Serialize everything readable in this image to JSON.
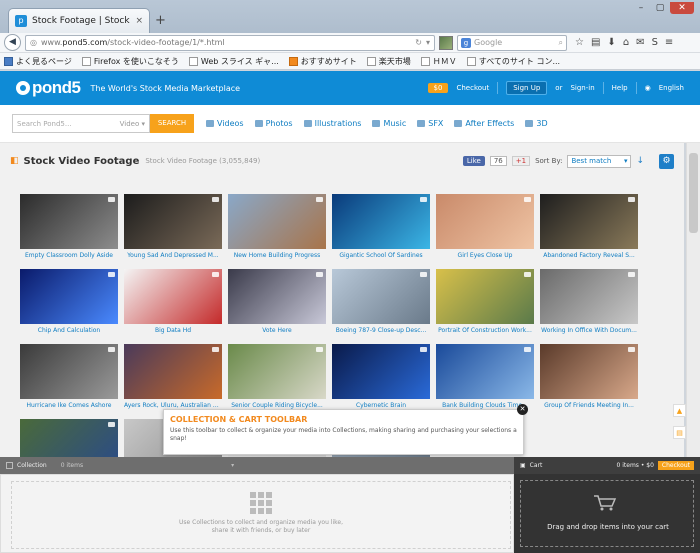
{
  "browser": {
    "tab_title": "Stock Footage | Stock ...",
    "tab_close": "×",
    "new_tab": "+",
    "url_prefix": "www.",
    "url_domain": "pond5.com",
    "url_path": "/stock-video-footage/1/*.html",
    "search_placeholder": "Google",
    "bookmarks": [
      "よく見るページ",
      "Firefox を使いこなそう",
      "Web スライス ギャ...",
      "おすすめサイト",
      "楽天市場",
      "ＨＭＶ",
      "すべてのサイト コン..."
    ]
  },
  "site": {
    "logo": "pond5",
    "tagline": "The World's Stock Media Marketplace",
    "cart_badge": "$0",
    "checkout": "Checkout",
    "signup": "Sign Up",
    "or": "or",
    "signin": "Sign-in",
    "help": "Help",
    "language": "English",
    "search_placeholder": "Search Pond5...",
    "search_filter": "Video",
    "search_button": "SEARCH",
    "categories": [
      "Videos",
      "Photos",
      "Illustrations",
      "Music",
      "SFX",
      "After Effects",
      "3D"
    ]
  },
  "page": {
    "title": "Stock Video Footage",
    "count": "Stock Video Footage (3,055,849)",
    "like": "Like",
    "like_count": "76",
    "gplus": "+1",
    "sort_label": "Sort By:",
    "sort_value": "Best match"
  },
  "clips": [
    {
      "caption": "Empty Classroom Dolly Aside",
      "colors": [
        "#2b2b2b",
        "#8d8d8d"
      ]
    },
    {
      "caption": "Young Sad And Depressed M...",
      "colors": [
        "#1c1c1c",
        "#7a6a58"
      ]
    },
    {
      "caption": "New Home Building Progress",
      "colors": [
        "#8aa8c8",
        "#a8744a"
      ]
    },
    {
      "caption": "Gigantic School Of Sardines",
      "colors": [
        "#0a3a7a",
        "#3bb6e6"
      ]
    },
    {
      "caption": "Girl Eyes Close Up",
      "colors": [
        "#c98a6a",
        "#efc4a4"
      ]
    },
    {
      "caption": "Abandoned Factory Reveal S...",
      "colors": [
        "#1e1e1e",
        "#8a7a5a"
      ]
    },
    {
      "caption": "Chip And Calculation",
      "colors": [
        "#0a1a6a",
        "#4a8aff"
      ]
    },
    {
      "caption": "Big Data Hd",
      "colors": [
        "#f4f4f4",
        "#c42a2a"
      ]
    },
    {
      "caption": "Vote Here",
      "colors": [
        "#3a3a4a",
        "#c8c8d8"
      ]
    },
    {
      "caption": "Boeing 787-9 Close-up Desc...",
      "colors": [
        "#b8c8d8",
        "#6a7a8a"
      ]
    },
    {
      "caption": "Portrait Of Construction Work...",
      "colors": [
        "#d8c04a",
        "#5a7a4a"
      ]
    },
    {
      "caption": "Working In Office With Docum...",
      "colors": [
        "#6a6a6a",
        "#c8c8c8"
      ]
    },
    {
      "caption": "Hurricane Ike Comes Ashore",
      "colors": [
        "#3a3a3a",
        "#9a9a9a"
      ]
    },
    {
      "caption": "Ayers Rock, Uluru, Australian C...",
      "colors": [
        "#4a3a5a",
        "#c86a2a"
      ]
    },
    {
      "caption": "Senior Couple Riding Bicycle...",
      "colors": [
        "#6a8a4a",
        "#d8d8c8"
      ]
    },
    {
      "caption": "Cybernetic Brain",
      "colors": [
        "#0a1a4a",
        "#2a6ad8"
      ]
    },
    {
      "caption": "Bank Building Clouds Time...",
      "colors": [
        "#1a4a9a",
        "#8ab8e8"
      ]
    },
    {
      "caption": "Group Of Friends Meeting In...",
      "colors": [
        "#5a3a2a",
        "#d8a88a"
      ]
    },
    {
      "caption": "",
      "colors": [
        "#4a6a3a",
        "#2a4a8a"
      ]
    },
    {
      "caption": "",
      "colors": [
        "#c8c8c8",
        "#8a8a8a"
      ]
    },
    {
      "caption": "",
      "colors": [
        "#f0f0f0",
        "#dddddd"
      ]
    },
    {
      "caption": "",
      "colors": [
        "#a8b8c8",
        "#6a7a8a"
      ]
    }
  ],
  "tooltip": {
    "title": "COLLECTION & CART TOOLBAR",
    "body": "Use this toolbar to collect & organize your media into Collections, making sharing and purchasing your selections a snap!"
  },
  "collection": {
    "label": "Collection",
    "count": "0 items",
    "empty_msg_1": "Use Collections to collect and organize media you like,",
    "empty_msg_2": "share it with friends, or buy later"
  },
  "cart": {
    "label": "Cart",
    "summary": "0 items • $0",
    "checkout": "Checkout",
    "empty_msg": "Drag and drop items into your cart"
  },
  "colors": {
    "brand_blue": "#0f8bd6",
    "accent_orange": "#f7a21b",
    "link_blue": "#0f7dc2"
  }
}
